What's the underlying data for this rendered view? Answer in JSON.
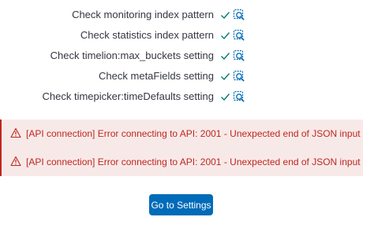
{
  "checks": [
    {
      "label": "Check monitoring index pattern",
      "icon": "check-icon",
      "action_icon": "inspect-icon"
    },
    {
      "label": "Check statistics index pattern",
      "icon": "check-icon",
      "action_icon": "inspect-icon"
    },
    {
      "label": "Check timelion:max_buckets setting",
      "icon": "check-icon",
      "action_icon": "inspect-icon"
    },
    {
      "label": "Check metaFields setting",
      "icon": "check-icon",
      "action_icon": "inspect-icon"
    },
    {
      "label": "Check timepicker:timeDefaults setting",
      "icon": "check-icon",
      "action_icon": "inspect-icon"
    }
  ],
  "errors": [
    {
      "message": "[API connection] Error connecting to API: 2001 - Unexpected end of JSON input",
      "icon": "warning-icon"
    },
    {
      "message": "[API connection] Error connecting to API: 2001 - Unexpected end of JSON input",
      "icon": "warning-icon"
    }
  ],
  "settings_button": {
    "label": "Go to Settings"
  },
  "colors": {
    "success": "#017d73",
    "link": "#006bb8",
    "danger": "#bd271e",
    "danger_bg": "#f8e9e9",
    "text": "#343741"
  }
}
